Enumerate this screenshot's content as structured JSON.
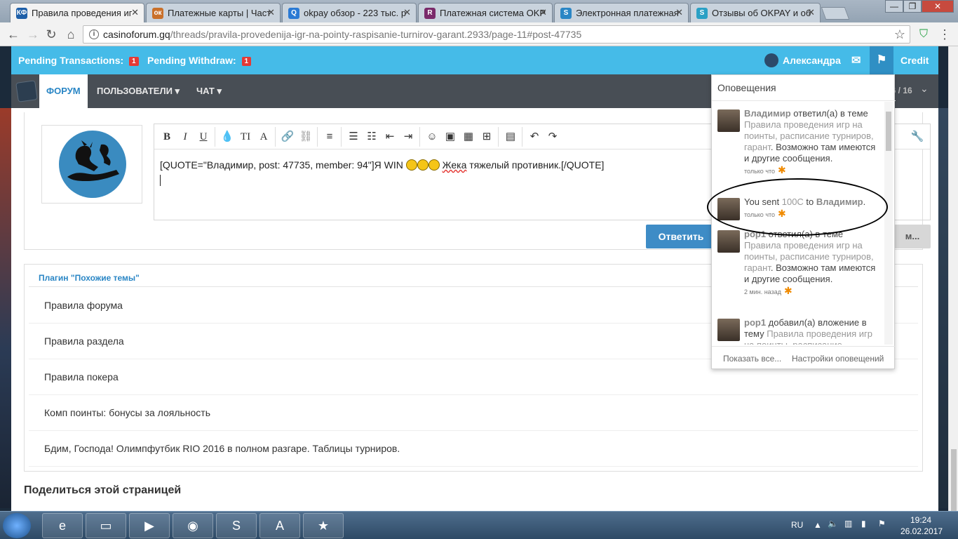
{
  "browser": {
    "tabs": [
      {
        "title": "Правила проведения иг",
        "favicon": "КФ",
        "color": "#1e5fa8"
      },
      {
        "title": "Платежные карты | Част",
        "favicon": "ок",
        "color": "#c9702a"
      },
      {
        "title": "okpay обзор - 223 тыс. р",
        "favicon": "Q",
        "color": "#2a7ad4"
      },
      {
        "title": "Платежная система OKP",
        "favicon": "R",
        "color": "#7a2a6a"
      },
      {
        "title": "Электронная платежная",
        "favicon": "S",
        "color": "#2a86c5"
      },
      {
        "title": "Отзывы об OKPAY и об",
        "favicon": "S",
        "color": "#2aa0c5"
      }
    ],
    "url_host": "casinoforum.gq",
    "url_path": "/threads/pravila-provedenija-igr-na-pointy-raspisanie-turnirov-garant.2933/page-11#post-47735"
  },
  "topbar": {
    "pending_transactions_label": "Pending Transactions:",
    "pending_transactions_count": "1",
    "pending_withdraw_label": "Pending Withdraw:",
    "pending_withdraw_count": "1",
    "username": "Александра",
    "credit_label": "Credit"
  },
  "nav": {
    "forum": "ФОРУМ",
    "users": "ПОЛЬЗОВАТЕЛИ",
    "chat": "ЧАТ",
    "pager": "16 / 16"
  },
  "editor": {
    "text_before": "[QUOTE=\"Владимир, post: 47735, member: 94\"]Я WIN ",
    "text_word": "Жека",
    "text_after": " тяжелый противник.[/QUOTE]",
    "reply_button": "Ответить",
    "more_button": "м..."
  },
  "similar": {
    "title": "Плагин \"Похожие темы\"",
    "items": [
      "Правила форума",
      "Правила раздела",
      "Правила покера",
      "Комп поинты: бонусы за лояльность",
      "Бдим, Господа! Олимпфутбик RIO 2016 в полном разгаре. Таблицы турниров."
    ]
  },
  "share_title": "Поделиться этой страницей",
  "notifications": {
    "title": "Оповещения",
    "items": [
      {
        "user": "Владимир",
        "action": " ответил(а) в теме ",
        "link": "Правила проведения игр на поинты, расписание турниров, гарант",
        "rest": ". Возможно там имеются и другие сообщения.",
        "time": "только что"
      },
      {
        "pre": "You sent ",
        "amount": "100C",
        "mid": " to ",
        "user": "Владимир",
        "post": ".",
        "time": "только что"
      },
      {
        "user": "pop1",
        "action": " ответил(а) в теме ",
        "link": "Правила проведения игр на поинты, расписание турниров, гарант",
        "rest": ". Возможно там имеются и другие сообщения.",
        "time": "2 мин. назад"
      },
      {
        "user": "pop1",
        "action": " добавил(а) вложение в тему ",
        "link": "Правила проведения игр на поинты, расписание"
      }
    ],
    "show_all": "Показать все...",
    "settings": "Настройки оповещений"
  },
  "taskbar": {
    "lang": "RU",
    "time": "19:24",
    "date": "26.02.2017"
  }
}
